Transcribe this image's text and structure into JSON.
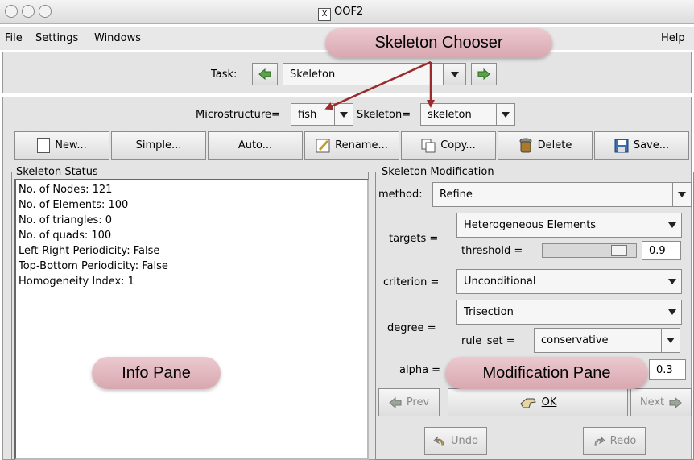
{
  "window": {
    "title": "OOF2",
    "x_icon": "X"
  },
  "menubar": {
    "file": "File",
    "settings": "Settings",
    "windows": "Windows",
    "help": "Help"
  },
  "task": {
    "label": "Task:",
    "value": "Skeleton"
  },
  "chooser": {
    "microstructure_label": "Microstructure=",
    "microstructure_value": "fish",
    "skeleton_label": "Skeleton=",
    "skeleton_value": "skeleton"
  },
  "toolbar": {
    "new": "New...",
    "simple": "Simple...",
    "auto": "Auto...",
    "rename": "Rename...",
    "copy": "Copy...",
    "delete": "Delete",
    "save": "Save..."
  },
  "status": {
    "title": "Skeleton Status",
    "lines": [
      "No. of Nodes: 121",
      "No. of Elements: 100",
      "No. of triangles: 0",
      "No. of quads: 100",
      "Left-Right Periodicity: False",
      "Top-Bottom Periodicity: False",
      "Homogeneity Index: 1"
    ]
  },
  "modification": {
    "title": "Skeleton Modification",
    "method_label": "method:",
    "method_value": "Refine",
    "targets_label": "targets =",
    "targets_value": "Heterogeneous Elements",
    "threshold_label": "threshold =",
    "threshold_value": "0.9",
    "threshold_level": 0.9,
    "criterion_label": "criterion =",
    "criterion_value": "Unconditional",
    "degree_label": "degree =",
    "degree_value": "Trisection",
    "ruleset_label": "rule_set =",
    "ruleset_value": "conservative",
    "alpha_label": "alpha =",
    "alpha_value": "0.3",
    "prev": "Prev",
    "ok": "OK",
    "next": "Next",
    "undo": "Undo",
    "redo": "Redo"
  },
  "annotations": {
    "skeleton_chooser": "Skeleton Chooser",
    "info_pane": "Info Pane",
    "modification_pane": "Modification Pane"
  },
  "colors": {
    "annotation_bubble": "#e2b5bd",
    "arrow": "#9b2a2a",
    "arrow_button": "#3f8f2f"
  }
}
